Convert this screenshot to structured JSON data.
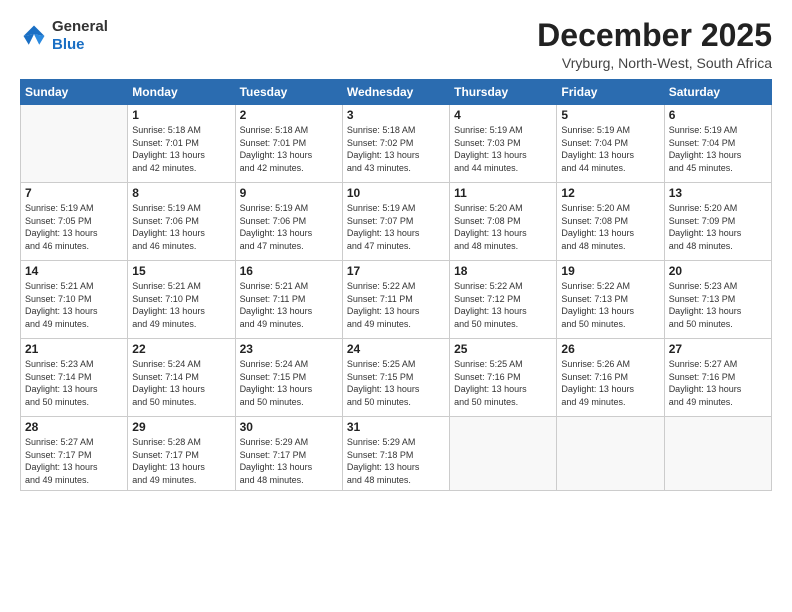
{
  "logo": {
    "line1": "General",
    "line2": "Blue"
  },
  "title": "December 2025",
  "subtitle": "Vryburg, North-West, South Africa",
  "days_header": [
    "Sunday",
    "Monday",
    "Tuesday",
    "Wednesday",
    "Thursday",
    "Friday",
    "Saturday"
  ],
  "weeks": [
    [
      {
        "day": "",
        "info": ""
      },
      {
        "day": "1",
        "info": "Sunrise: 5:18 AM\nSunset: 7:01 PM\nDaylight: 13 hours\nand 42 minutes."
      },
      {
        "day": "2",
        "info": "Sunrise: 5:18 AM\nSunset: 7:01 PM\nDaylight: 13 hours\nand 42 minutes."
      },
      {
        "day": "3",
        "info": "Sunrise: 5:18 AM\nSunset: 7:02 PM\nDaylight: 13 hours\nand 43 minutes."
      },
      {
        "day": "4",
        "info": "Sunrise: 5:19 AM\nSunset: 7:03 PM\nDaylight: 13 hours\nand 44 minutes."
      },
      {
        "day": "5",
        "info": "Sunrise: 5:19 AM\nSunset: 7:04 PM\nDaylight: 13 hours\nand 44 minutes."
      },
      {
        "day": "6",
        "info": "Sunrise: 5:19 AM\nSunset: 7:04 PM\nDaylight: 13 hours\nand 45 minutes."
      }
    ],
    [
      {
        "day": "7",
        "info": "Sunrise: 5:19 AM\nSunset: 7:05 PM\nDaylight: 13 hours\nand 46 minutes."
      },
      {
        "day": "8",
        "info": "Sunrise: 5:19 AM\nSunset: 7:06 PM\nDaylight: 13 hours\nand 46 minutes."
      },
      {
        "day": "9",
        "info": "Sunrise: 5:19 AM\nSunset: 7:06 PM\nDaylight: 13 hours\nand 47 minutes."
      },
      {
        "day": "10",
        "info": "Sunrise: 5:19 AM\nSunset: 7:07 PM\nDaylight: 13 hours\nand 47 minutes."
      },
      {
        "day": "11",
        "info": "Sunrise: 5:20 AM\nSunset: 7:08 PM\nDaylight: 13 hours\nand 48 minutes."
      },
      {
        "day": "12",
        "info": "Sunrise: 5:20 AM\nSunset: 7:08 PM\nDaylight: 13 hours\nand 48 minutes."
      },
      {
        "day": "13",
        "info": "Sunrise: 5:20 AM\nSunset: 7:09 PM\nDaylight: 13 hours\nand 48 minutes."
      }
    ],
    [
      {
        "day": "14",
        "info": "Sunrise: 5:21 AM\nSunset: 7:10 PM\nDaylight: 13 hours\nand 49 minutes."
      },
      {
        "day": "15",
        "info": "Sunrise: 5:21 AM\nSunset: 7:10 PM\nDaylight: 13 hours\nand 49 minutes."
      },
      {
        "day": "16",
        "info": "Sunrise: 5:21 AM\nSunset: 7:11 PM\nDaylight: 13 hours\nand 49 minutes."
      },
      {
        "day": "17",
        "info": "Sunrise: 5:22 AM\nSunset: 7:11 PM\nDaylight: 13 hours\nand 49 minutes."
      },
      {
        "day": "18",
        "info": "Sunrise: 5:22 AM\nSunset: 7:12 PM\nDaylight: 13 hours\nand 50 minutes."
      },
      {
        "day": "19",
        "info": "Sunrise: 5:22 AM\nSunset: 7:13 PM\nDaylight: 13 hours\nand 50 minutes."
      },
      {
        "day": "20",
        "info": "Sunrise: 5:23 AM\nSunset: 7:13 PM\nDaylight: 13 hours\nand 50 minutes."
      }
    ],
    [
      {
        "day": "21",
        "info": "Sunrise: 5:23 AM\nSunset: 7:14 PM\nDaylight: 13 hours\nand 50 minutes."
      },
      {
        "day": "22",
        "info": "Sunrise: 5:24 AM\nSunset: 7:14 PM\nDaylight: 13 hours\nand 50 minutes."
      },
      {
        "day": "23",
        "info": "Sunrise: 5:24 AM\nSunset: 7:15 PM\nDaylight: 13 hours\nand 50 minutes."
      },
      {
        "day": "24",
        "info": "Sunrise: 5:25 AM\nSunset: 7:15 PM\nDaylight: 13 hours\nand 50 minutes."
      },
      {
        "day": "25",
        "info": "Sunrise: 5:25 AM\nSunset: 7:16 PM\nDaylight: 13 hours\nand 50 minutes."
      },
      {
        "day": "26",
        "info": "Sunrise: 5:26 AM\nSunset: 7:16 PM\nDaylight: 13 hours\nand 49 minutes."
      },
      {
        "day": "27",
        "info": "Sunrise: 5:27 AM\nSunset: 7:16 PM\nDaylight: 13 hours\nand 49 minutes."
      }
    ],
    [
      {
        "day": "28",
        "info": "Sunrise: 5:27 AM\nSunset: 7:17 PM\nDaylight: 13 hours\nand 49 minutes."
      },
      {
        "day": "29",
        "info": "Sunrise: 5:28 AM\nSunset: 7:17 PM\nDaylight: 13 hours\nand 49 minutes."
      },
      {
        "day": "30",
        "info": "Sunrise: 5:29 AM\nSunset: 7:17 PM\nDaylight: 13 hours\nand 48 minutes."
      },
      {
        "day": "31",
        "info": "Sunrise: 5:29 AM\nSunset: 7:18 PM\nDaylight: 13 hours\nand 48 minutes."
      },
      {
        "day": "",
        "info": ""
      },
      {
        "day": "",
        "info": ""
      },
      {
        "day": "",
        "info": ""
      }
    ]
  ]
}
